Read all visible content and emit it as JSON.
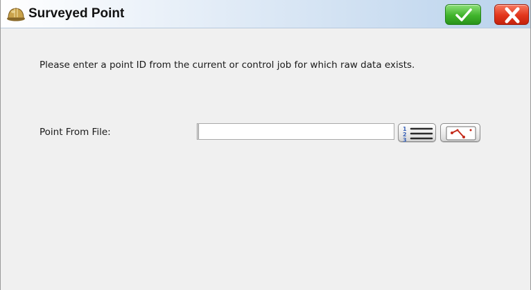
{
  "window": {
    "title": "Surveyed Point",
    "title_icon": "hard-hat-icon",
    "ok_icon": "checkmark-icon",
    "close_icon": "close-x-icon"
  },
  "main": {
    "instruction": "Please enter a point ID from the current or control job for which raw data exists.",
    "point_field": {
      "label": "Point From File:",
      "value": "",
      "placeholder": ""
    },
    "list_button_icon": "numbered-list-icon",
    "map_button_icon": "map-select-icon"
  },
  "colors": {
    "ok_green": "#40b42c",
    "close_red": "#e2361c",
    "title_gradient_end": "#b9d2ec",
    "body_background": "#f0f0f0"
  }
}
